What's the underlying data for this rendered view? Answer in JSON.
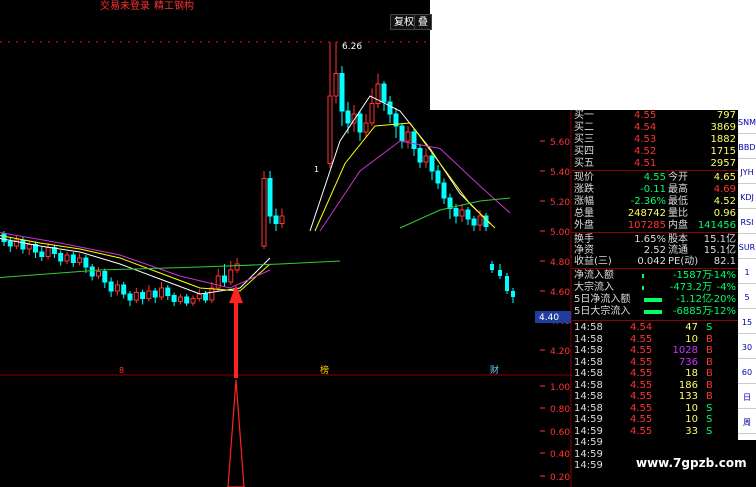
{
  "topbar": {
    "login": "交易未登录",
    "trade": "精工钢构",
    "btn_fq": "复权",
    "btn_die": "叠"
  },
  "axis": {
    "price_ticks": [
      "5.60",
      "5.40",
      "5.20",
      "5.00",
      "4.80",
      "4.60",
      "4.40",
      "4.20"
    ],
    "current_price_tag": "4.40",
    "high_mark": "6.26",
    "ind_ticks": [
      "1.00",
      "0.80",
      "0.60",
      "0.40",
      "0.20"
    ],
    "flag_1": "1",
    "flag_8": "8",
    "flag_bang": "榜",
    "flag_cai": "财"
  },
  "colors": {
    "up": "#ff3333",
    "down": "#00ffff",
    "ma5": "#ffffff",
    "ma10": "#ffff00",
    "ma20": "#cc33cc",
    "ma60": "#33cc33",
    "grid": "#8b0000"
  },
  "orderbook": [
    {
      "label": "买一",
      "price": "4.55",
      "vol": "797"
    },
    {
      "label": "买二",
      "price": "4.54",
      "vol": "3869"
    },
    {
      "label": "买三",
      "price": "4.53",
      "vol": "1882"
    },
    {
      "label": "买四",
      "price": "4.52",
      "vol": "1715"
    },
    {
      "label": "买五",
      "price": "4.51",
      "vol": "2957"
    }
  ],
  "stats": [
    {
      "l1": "现价",
      "v1": "4.55",
      "l2": "今开",
      "v2": "4.65"
    },
    {
      "l1": "涨跌",
      "v1": "-0.11",
      "l2": "最高",
      "v2": "4.69"
    },
    {
      "l1": "涨幅",
      "v1": "-2.36%",
      "l2": "最低",
      "v2": "4.52"
    },
    {
      "l1": "总量",
      "v1": "248742",
      "l2": "量比",
      "v2": "0.96"
    },
    {
      "l1": "外盘",
      "v1": "107285",
      "l2": "内盘",
      "v2": "141456"
    }
  ],
  "stats2": [
    {
      "l1": "换手",
      "v1": "1.65%",
      "l2": "股本",
      "v2": "15.1亿"
    },
    {
      "l1": "净资",
      "v1": "2.52",
      "l2": "流通",
      "v2": "15.1亿"
    },
    {
      "l1": "收益(三)",
      "v1": "0.042",
      "l2": "PE(动)",
      "v2": "82.1"
    }
  ],
  "flows": [
    {
      "label": "净流入额",
      "val": "-1587万",
      "pct": "-14%"
    },
    {
      "label": "大宗流入",
      "val": "-473.2万",
      "pct": "-4%"
    },
    {
      "label": "5日净流入额",
      "val": "-1.12亿",
      "pct": "-20%"
    },
    {
      "label": "5日大宗流入",
      "val": "-6885万",
      "pct": "-12%"
    }
  ],
  "ticks": [
    {
      "t": "14:58",
      "p": "4.54",
      "v": "47",
      "d": "S"
    },
    {
      "t": "14:58",
      "p": "4.55",
      "v": "10",
      "d": "B"
    },
    {
      "t": "14:58",
      "p": "4.55",
      "v": "1028",
      "d": "B"
    },
    {
      "t": "14:58",
      "p": "4.55",
      "v": "736",
      "d": "B"
    },
    {
      "t": "14:58",
      "p": "4.55",
      "v": "18",
      "d": "B"
    },
    {
      "t": "14:58",
      "p": "4.55",
      "v": "186",
      "d": "B"
    },
    {
      "t": "14:58",
      "p": "4.55",
      "v": "133",
      "d": "B"
    },
    {
      "t": "14:58",
      "p": "4.55",
      "v": "10",
      "d": "S"
    },
    {
      "t": "14:59",
      "p": "4.55",
      "v": "10",
      "d": "S"
    },
    {
      "t": "14:59",
      "p": "4.55",
      "v": "33",
      "d": "S"
    },
    {
      "t": "14:59",
      "p": "",
      "v": "",
      "d": ""
    },
    {
      "t": "14:59",
      "p": "",
      "v": "",
      "d": ""
    },
    {
      "t": "14:59",
      "p": "",
      "v": "",
      "d": ""
    }
  ],
  "rightbar": [
    "SNM",
    "BBD",
    "JYH",
    "KDJ",
    "RSI",
    "SUR",
    "1",
    "5",
    "15",
    "30",
    "60",
    "日",
    "周"
  ],
  "watermark": "www.7gpzb.com"
}
